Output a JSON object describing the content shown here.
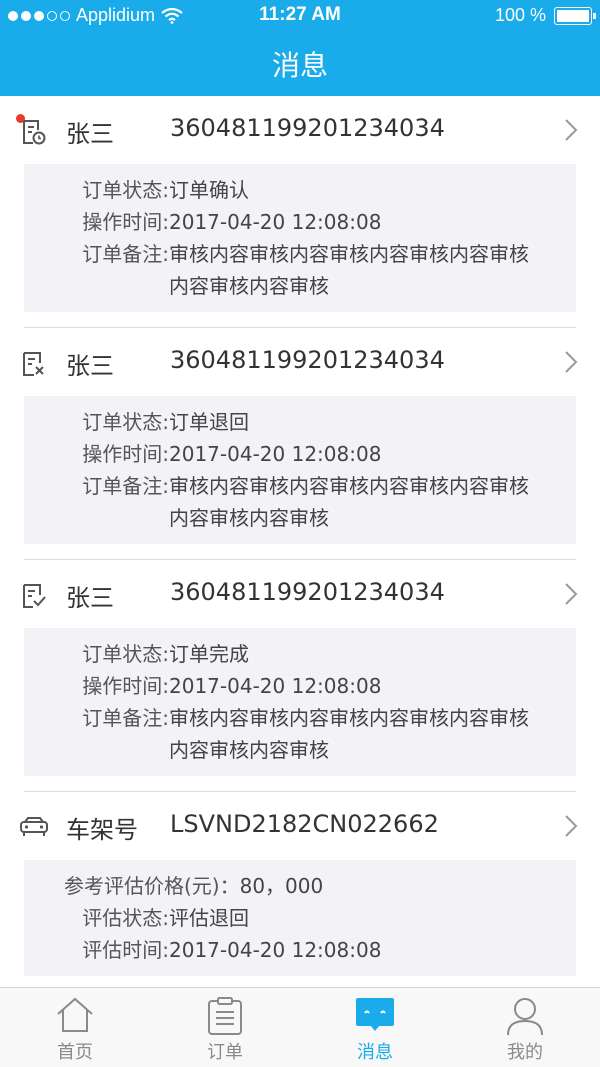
{
  "status_bar": {
    "carrier": "Applidium",
    "time": "11:27 AM",
    "battery": "100 %"
  },
  "nav": {
    "title": "消息"
  },
  "messages": [
    {
      "name": "张三",
      "id": "360481199201234034",
      "unread": true,
      "icon": "order-pending-icon",
      "fields": [
        {
          "k": "订单状态:",
          "v": "订单确认"
        },
        {
          "k": "操作时间:",
          "v": "2017-04-20 12:08:08"
        },
        {
          "k": "订单备注:",
          "v": "审核内容审核内容审核内容审核内容审核内容审核内容审核"
        }
      ]
    },
    {
      "name": "张三",
      "id": "360481199201234034",
      "unread": false,
      "icon": "order-returned-icon",
      "fields": [
        {
          "k": "订单状态:",
          "v": "订单退回"
        },
        {
          "k": "操作时间:",
          "v": "2017-04-20 12:08:08"
        },
        {
          "k": "订单备注:",
          "v": "审核内容审核内容审核内容审核内容审核内容审核内容审核"
        }
      ]
    },
    {
      "name": "张三",
      "id": "360481199201234034",
      "unread": false,
      "icon": "order-complete-icon",
      "fields": [
        {
          "k": "订单状态:",
          "v": "订单完成"
        },
        {
          "k": "操作时间:",
          "v": "2017-04-20 12:08:08"
        },
        {
          "k": "订单备注:",
          "v": "审核内容审核内容审核内容审核内容审核内容审核内容审核"
        }
      ]
    },
    {
      "name": "车架号",
      "id": "LSVND2182CN022662",
      "unread": false,
      "icon": "car-icon",
      "fields": [
        {
          "k": "参考评估价格(元)：",
          "v": "80，000"
        },
        {
          "k": "评估状态:",
          "v": "评估退回"
        },
        {
          "k": "评估时间:",
          "v": "2017-04-20 12:08:08"
        }
      ]
    }
  ],
  "tabbar": [
    {
      "label": "首页",
      "icon": "home-icon",
      "active": false
    },
    {
      "label": "订单",
      "icon": "clipboard-icon",
      "active": false
    },
    {
      "label": "消息",
      "icon": "message-icon",
      "active": true
    },
    {
      "label": "我的",
      "icon": "person-icon",
      "active": false
    }
  ],
  "colors": {
    "brand": "#1aabea",
    "unread_dot": "#e83a2f"
  }
}
